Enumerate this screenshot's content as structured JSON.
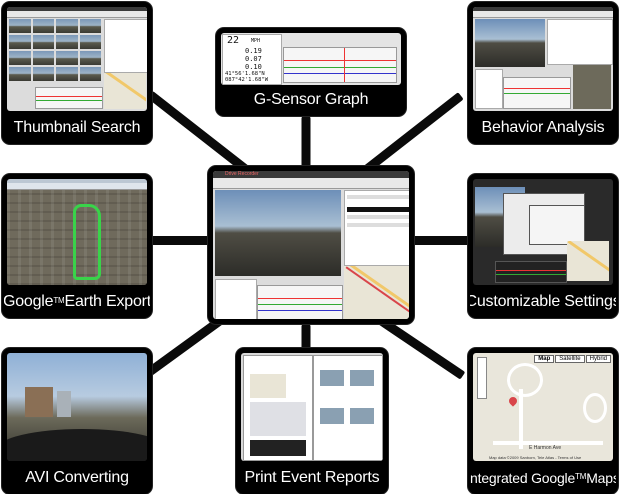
{
  "diagram": {
    "center_app": {
      "title_bar": "Drive Recorder"
    },
    "features": [
      {
        "id": "thumbnail-search",
        "label": "Thumbnail Search"
      },
      {
        "id": "g-sensor-graph",
        "label": "G-Sensor Graph"
      },
      {
        "id": "behavior-analysis",
        "label": "Behavior Analysis"
      },
      {
        "id": "google-earth-export",
        "label_pre": "Google",
        "label_tm": "TM",
        "label_post": " Earth Export"
      },
      {
        "id": "customizable-settings",
        "label": "Customizable Settings"
      },
      {
        "id": "avi-converting",
        "label": "AVI Converting"
      },
      {
        "id": "print-event-reports",
        "label": "Print Event Reports"
      },
      {
        "id": "integrated-google-maps",
        "label_pre": "Integrated Google",
        "label_tm": "TM",
        "label_post": " Maps"
      }
    ],
    "g_sensor_readout": {
      "speed": "22",
      "speed_unit": "MPH",
      "x": "0.19",
      "y": "0.07",
      "z": "0.10",
      "lat": "41°56'1.68\"N",
      "lon": "087°42'1.68\"W"
    },
    "maps_tabs": [
      "Map",
      "Satellite",
      "Hybrid"
    ],
    "maps_street": "E Harmon Ave",
    "maps_footer": "Map data ©2009 Sanborn, Tele Atlas - Terms of Use"
  },
  "colors": {
    "card_bg": "#000000",
    "connector": "#0a0a0a",
    "label_text": "#ffffff",
    "accent_red": "#d9454a"
  }
}
